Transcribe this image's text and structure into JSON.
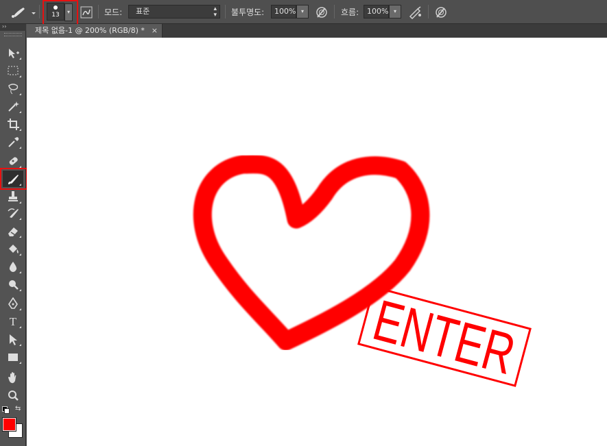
{
  "options_bar": {
    "brush_size": "13",
    "mode_label": "모드:",
    "mode_value": "표준",
    "opacity_label": "불투명도:",
    "opacity_value": "100%",
    "flow_label": "흐름:",
    "flow_value": "100%"
  },
  "document_tab": {
    "title": "제목 없음-1 @ 200% (RGB/8) *",
    "close": "×"
  },
  "colors": {
    "foreground": "#ff0000",
    "background": "#ffffff",
    "highlight": "#e81010"
  },
  "tools": [
    "move-icon",
    "marquee-icon",
    "lasso-icon",
    "magic-wand-icon",
    "crop-icon",
    "eyedropper-icon",
    "healing-brush-icon",
    "brush-icon",
    "clone-stamp-icon",
    "history-brush-icon",
    "eraser-icon",
    "paint-bucket-icon",
    "blur-icon",
    "dodge-icon",
    "pen-icon",
    "type-icon",
    "path-selection-icon",
    "rectangle-icon",
    "hand-icon",
    "zoom-icon"
  ],
  "tool_glyphs": {
    "type": "T"
  },
  "canvas": {
    "stamp_text": "ENTER"
  }
}
